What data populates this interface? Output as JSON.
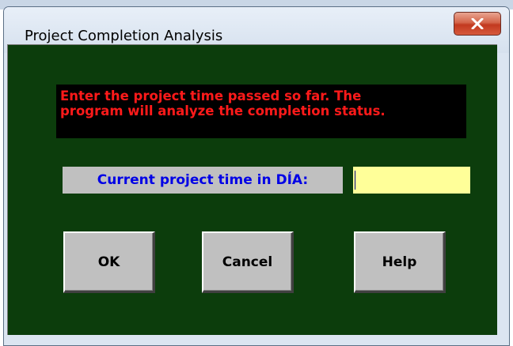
{
  "window": {
    "title": "Project Completion Analysis",
    "close_label": "X"
  },
  "message": {
    "line1": "Enter the project time passed so far.  The",
    "line2": "program will analyze the completion status."
  },
  "field": {
    "label": "Current project time in DÍA:",
    "value": ""
  },
  "buttons": {
    "ok": "OK",
    "cancel": "Cancel",
    "help": "Help"
  },
  "colors": {
    "client_background": "#0c3d0c",
    "message_text": "#ff1a1a",
    "label_text": "#0000e6",
    "input_background": "#ffff99"
  }
}
